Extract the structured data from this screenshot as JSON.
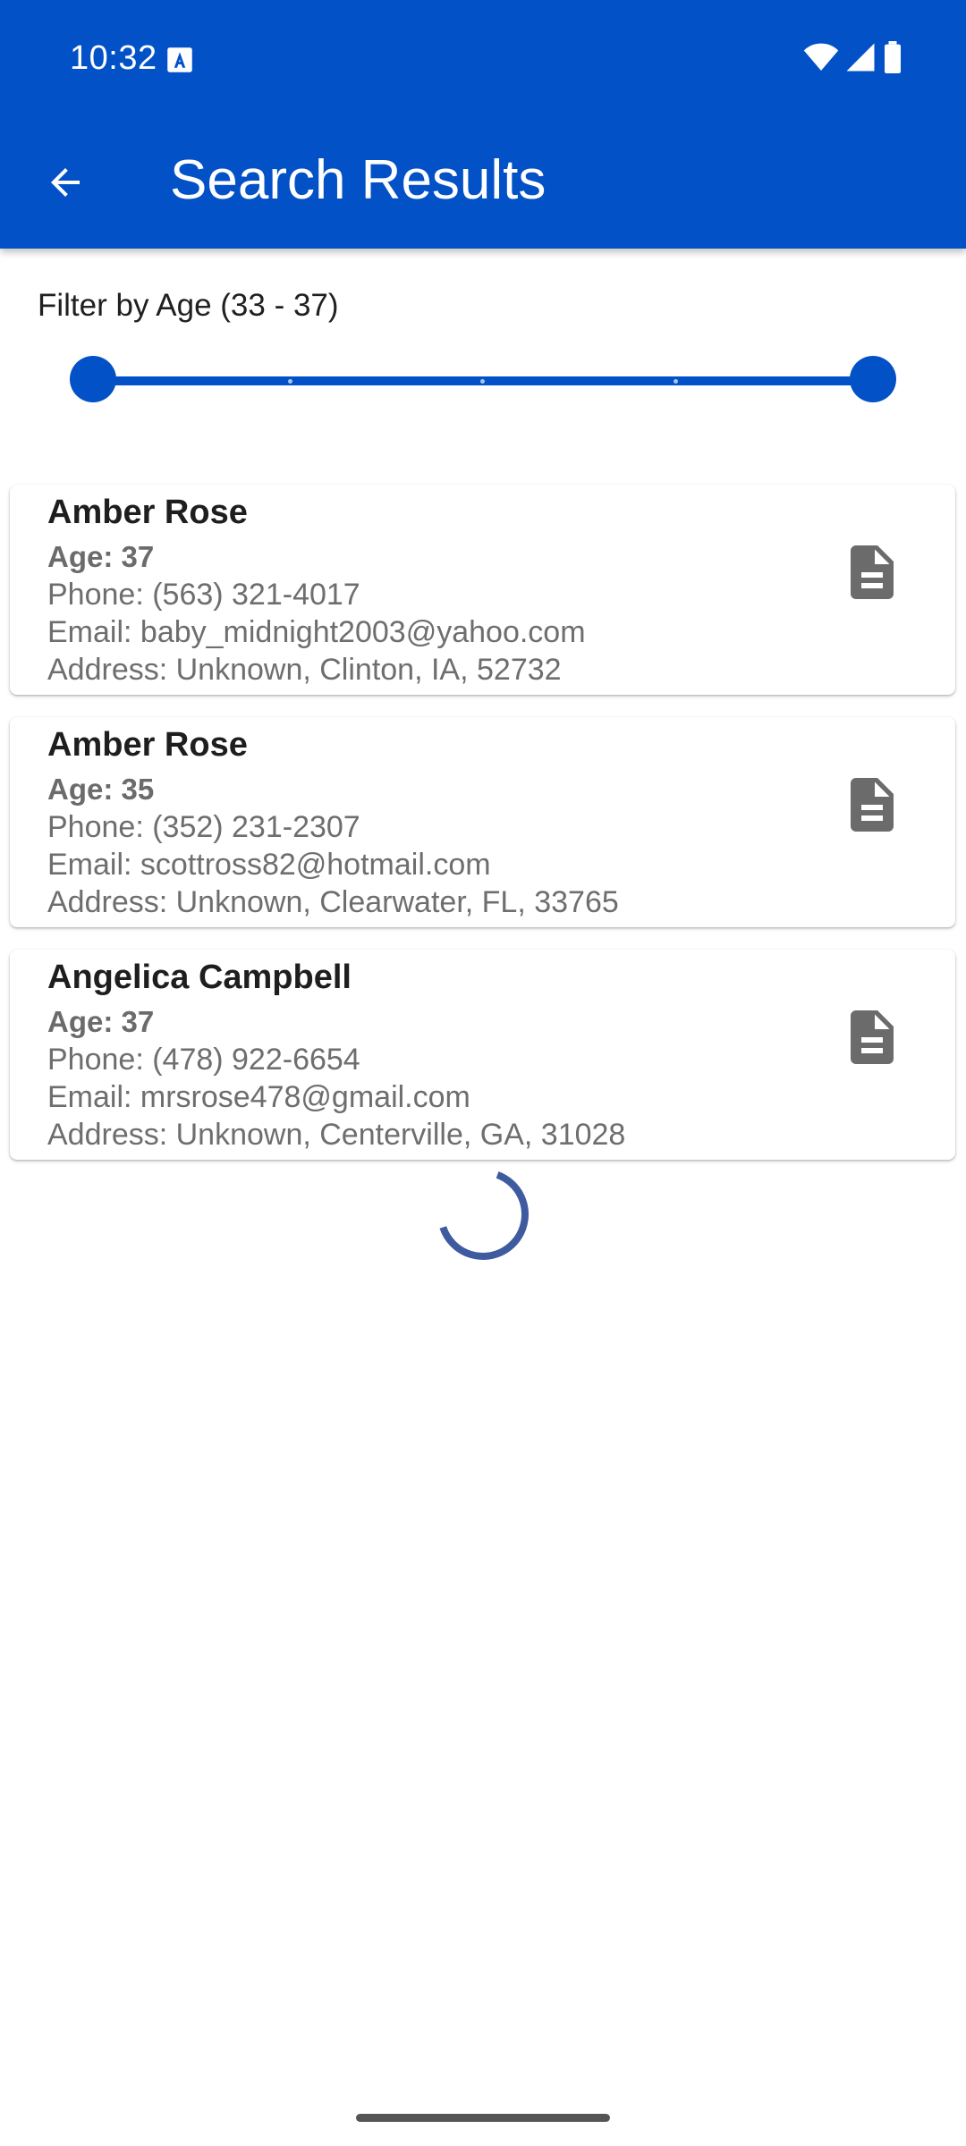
{
  "status_bar": {
    "time": "10:32"
  },
  "header": {
    "title": "Search Results",
    "background_color": "#0351c7"
  },
  "filter": {
    "label": "Filter by Age (33 - 37)",
    "min_age": 33,
    "max_age": 37,
    "selected_low": 33,
    "selected_high": 37,
    "accent_color": "#0351c7"
  },
  "results": [
    {
      "name": "Amber Rose",
      "age": "Age: 37",
      "phone": "Phone: (563) 321-4017",
      "email": "Email: baby_midnight2003@yahoo.com",
      "address": "Address: Unknown, Clinton, IA, 52732",
      "icon": "document-icon"
    },
    {
      "name": "Amber Rose",
      "age": "Age: 35",
      "phone": "Phone: (352) 231-2307",
      "email": "Email: scottross82@hotmail.com",
      "address": "Address: Unknown, Clearwater, FL, 33765",
      "icon": "document-icon"
    },
    {
      "name": "Angelica Campbell",
      "age": "Age: 37",
      "phone": "Phone: (478) 922-6654",
      "email": "Email: mrsrose478@gmail.com",
      "address": "Address: Unknown, Centerville, GA, 31028",
      "icon": "document-icon"
    }
  ],
  "loading": true
}
